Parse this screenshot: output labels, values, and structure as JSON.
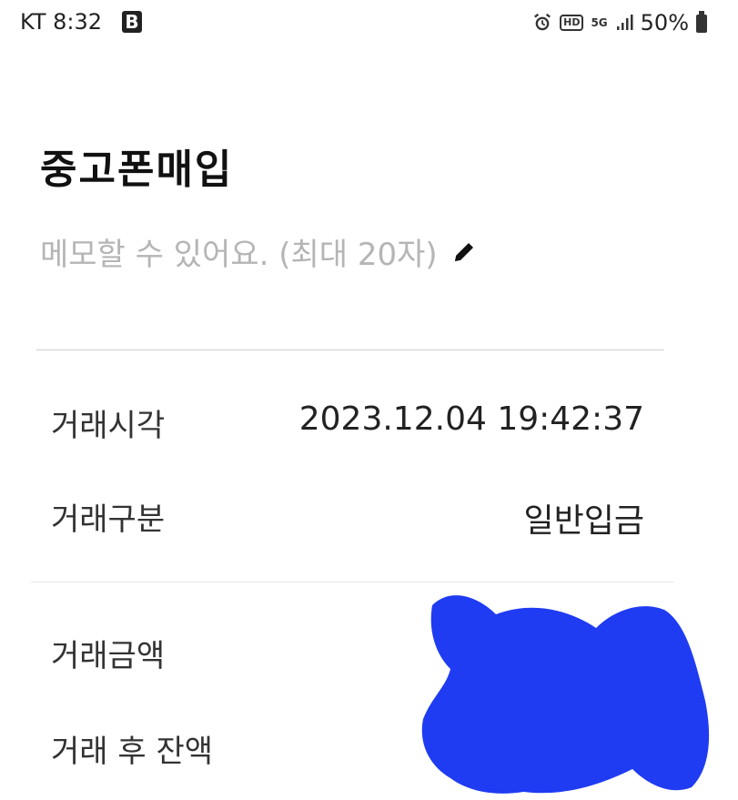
{
  "status_bar": {
    "carrier_time": "KT 8:32",
    "b_badge": "B",
    "hd_badge": "HD",
    "network_badge": "5G",
    "battery_percent": "50%",
    "icons": [
      "b-app-icon",
      "alarm-icon",
      "hd-voice-icon",
      "5g-icon",
      "signal-icon",
      "battery-icon"
    ]
  },
  "header": {
    "title": "중고폰매입",
    "memo_placeholder": "메모할 수 있어요. (최대 20자)",
    "edit_icon": "pencil-icon"
  },
  "details": [
    {
      "label": "거래시각",
      "value": "2023.12.04 19:42:37"
    },
    {
      "label": "거래구분",
      "value": "일반입금"
    },
    {
      "label": "거래금액",
      "value": ""
    },
    {
      "label": "거래 후 잔액",
      "value": ""
    }
  ],
  "colors": {
    "redaction": "#1f3cf2",
    "placeholder": "#b5b5b5",
    "divider": "#cfcfcf"
  }
}
